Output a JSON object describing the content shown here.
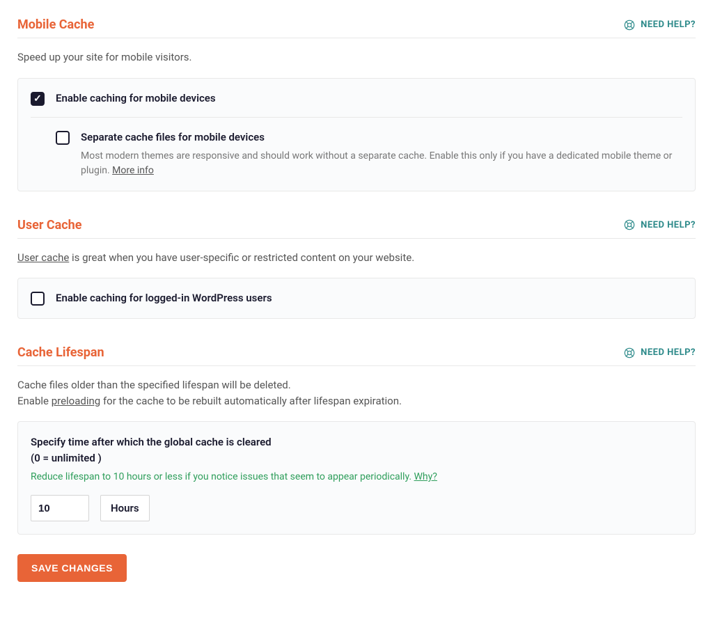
{
  "help_label": "NEED HELP?",
  "mobile_cache": {
    "title": "Mobile Cache",
    "desc": "Speed up your site for mobile visitors.",
    "enable_label": "Enable caching for mobile devices",
    "separate_label": "Separate cache files for mobile devices",
    "separate_help": "Most modern themes are responsive and should work without a separate cache. Enable this only if you have a dedicated mobile theme or plugin. ",
    "more_info": "More info"
  },
  "user_cache": {
    "title": "User Cache",
    "desc_link": "User cache",
    "desc_rest": " is great when you have user-specific or restricted content on your website.",
    "enable_label": "Enable caching for logged-in WordPress users"
  },
  "lifespan": {
    "title": "Cache Lifespan",
    "desc_line1": "Cache files older than the specified lifespan will be deleted.",
    "desc_enable": "Enable ",
    "desc_link": "preloading",
    "desc_rest": " for the cache to be rebuilt automatically after lifespan expiration.",
    "specify_line1": "Specify time after which the global cache is cleared",
    "specify_line2": "(0 = unlimited )",
    "tip_text": "Reduce lifespan to 10 hours or less if you notice issues that seem to appear periodically. ",
    "tip_why": "Why?",
    "value": "10",
    "unit": "Hours"
  },
  "save_label": "SAVE CHANGES"
}
